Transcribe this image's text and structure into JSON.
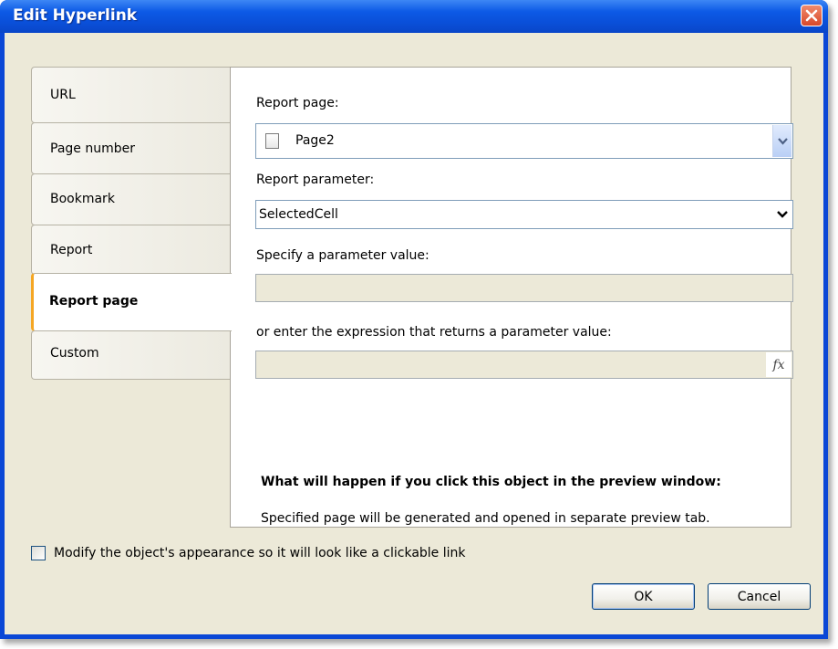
{
  "window": {
    "title": "Edit Hyperlink"
  },
  "tabs": [
    {
      "label": "URL"
    },
    {
      "label": "Page number"
    },
    {
      "label": "Bookmark"
    },
    {
      "label": "Report"
    },
    {
      "label": "Report page"
    },
    {
      "label": "Custom"
    }
  ],
  "active_tab": "Report page",
  "panel": {
    "report_page_label": "Report page:",
    "report_page_value": "Page2",
    "report_parameter_label": "Report parameter:",
    "report_parameter_value": "SelectedCell",
    "parameter_value_label": "Specify a parameter value:",
    "parameter_value": "",
    "expression_label": "or enter the expression that returns a parameter value:",
    "expression_value": "",
    "fx_label": "fx",
    "what_happens_heading": "What will happen if you click this object in the preview window:",
    "what_happens_text": "Specified page will be generated and opened in separate preview tab."
  },
  "checkbox": {
    "label": "Modify the object's appearance so it will look like a clickable link",
    "checked": false
  },
  "buttons": {
    "ok": "OK",
    "cancel": "Cancel"
  },
  "colors": {
    "titlebar": "#0a4fd8",
    "dialog_bg": "#ece9d8",
    "close_button": "#d8482a",
    "active_tab_marker": "#f5a623"
  }
}
